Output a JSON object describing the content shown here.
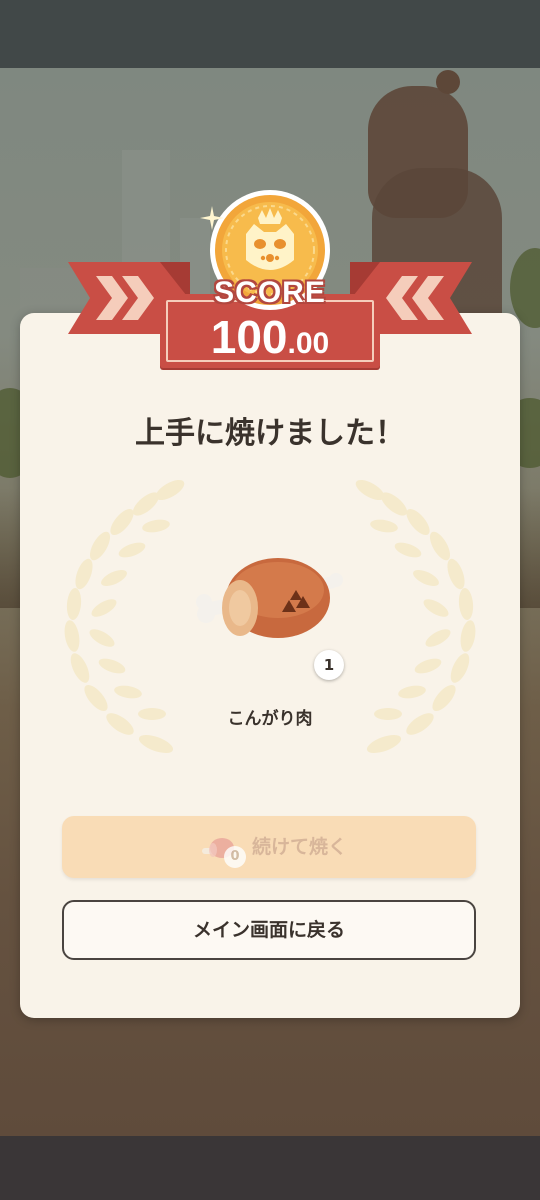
{
  "result": {
    "score_label": "SCORE",
    "score_int": "100",
    "score_dec": ".00",
    "headline": "上手に焼けました！",
    "item": {
      "name": "こんがり肉",
      "quantity": "1",
      "icon": "well-done-meat-icon"
    }
  },
  "buttons": {
    "continue_label": "続けて焼く",
    "continue_count": "0",
    "continue_disabled": true,
    "back_label": "メイン画面に戻る"
  },
  "colors": {
    "ribbon": "#c94e45",
    "card": "#f9f3e9",
    "continue_button": "#f9dcb6",
    "medal": "#f2a63a"
  }
}
